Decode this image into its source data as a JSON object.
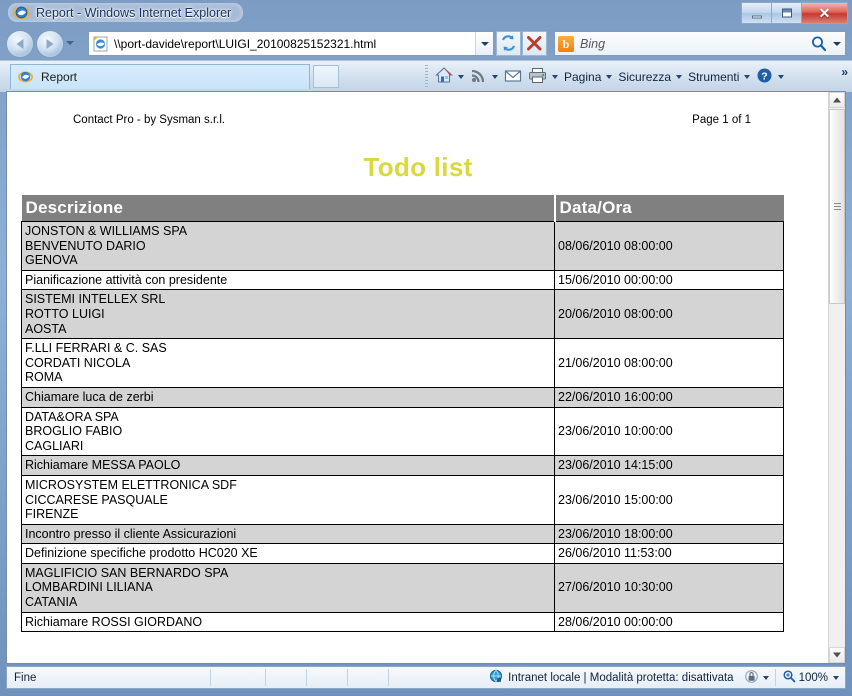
{
  "window": {
    "title": "Report - Windows Internet Explorer",
    "minimize_label": "Minimize",
    "maximize_label": "Restore",
    "close_label": "Close"
  },
  "address_bar": {
    "url": "\\\\port-davide\\report\\LUIGI_20100825152321.html",
    "back_label": "Back",
    "forward_label": "Forward",
    "refresh_label": "Refresh",
    "stop_label": "Stop"
  },
  "search": {
    "provider": "Bing",
    "provider_initial": "b",
    "placeholder": "Bing"
  },
  "tabs": {
    "items": [
      {
        "label": "Report"
      }
    ],
    "new_tab_label": ""
  },
  "command_bar": {
    "items": [
      {
        "label": "",
        "icon": "home-icon",
        "has_caret": true
      },
      {
        "label": "",
        "icon": "rss-icon",
        "has_caret": true
      },
      {
        "label": "",
        "icon": "mail-icon",
        "has_caret": false
      },
      {
        "label": "",
        "icon": "print-icon",
        "has_caret": true
      },
      {
        "label": "Pagina",
        "icon": "",
        "has_caret": true
      },
      {
        "label": "Sicurezza",
        "icon": "",
        "has_caret": true
      },
      {
        "label": "Strumenti",
        "icon": "",
        "has_caret": true
      },
      {
        "label": "",
        "icon": "help-icon",
        "has_caret": true
      }
    ],
    "overflow_label": "»"
  },
  "report": {
    "header_left": "Contact Pro - by Sysman s.r.l.",
    "header_right": "Page 1 of 1",
    "title": "Todo list",
    "title_color": "#d9d93c",
    "header_bg": "#808080",
    "alt_row_bg": "#d4d4d4",
    "columns": [
      "Descrizione",
      "Data/Ora"
    ],
    "rows": [
      {
        "descrizione": "JONSTON & WILLIAMS SPA\nBENVENUTO DARIO\nGENOVA",
        "data_ora": "08/06/2010 08:00:00",
        "shaded": true,
        "spaced": false
      },
      {
        "descrizione": "Pianificazione attività con presidente",
        "data_ora": "15/06/2010 00:00:00",
        "shaded": false,
        "spaced": false
      },
      {
        "descrizione": "SISTEMI INTELLEX SRL\nROTTO LUIGI\nAOSTA",
        "data_ora": "20/06/2010 08:00:00",
        "shaded": true,
        "spaced": false
      },
      {
        "descrizione": "F.LLI FERRARI & C. SAS\nCORDATI NICOLA\nROMA",
        "data_ora": "21/06/2010 08:00:00",
        "shaded": false,
        "spaced": false
      },
      {
        "descrizione": "Chiamare luca de zerbi",
        "data_ora": "22/06/2010 16:00:00",
        "shaded": true,
        "spaced": false
      },
      {
        "descrizione": "DATA&ORA SPA\nBROGLIO FABIO\nCAGLIARI",
        "data_ora": "23/06/2010 10:00:00",
        "shaded": false,
        "spaced": false
      },
      {
        "descrizione": "Richiamare MESSA PAOLO",
        "data_ora": "23/06/2010 14:15:00",
        "shaded": true,
        "spaced": false
      },
      {
        "descrizione": "MICROSYSTEM ELETTRONICA SDF\nCICCARESE PASQUALE\nFIRENZE",
        "data_ora": "23/06/2010 15:00:00",
        "shaded": false,
        "spaced": false
      },
      {
        "descrizione": "Incontro presso il cliente Assicurazioni",
        "data_ora": "23/06/2010 18:00:00",
        "shaded": true,
        "spaced": false
      },
      {
        "descrizione": "Definizione specifiche prodotto HC020 XE",
        "data_ora": "26/06/2010 11:53:00",
        "shaded": false,
        "spaced": false
      },
      {
        "descrizione": "MAGLIFICIO SAN BERNARDO SPA\nLOMBARDINI LILIANA\nCATANIA",
        "data_ora": "27/06/2010 10:30:00",
        "shaded": true,
        "spaced": true
      },
      {
        "descrizione": "Richiamare ROSSI GIORDANO",
        "data_ora": "28/06/2010 00:00:00",
        "shaded": false,
        "spaced": false
      }
    ]
  },
  "status_bar": {
    "status": "Fine",
    "zone": "Intranet locale | Modalità protetta: disattivata",
    "zoom": "100%"
  }
}
